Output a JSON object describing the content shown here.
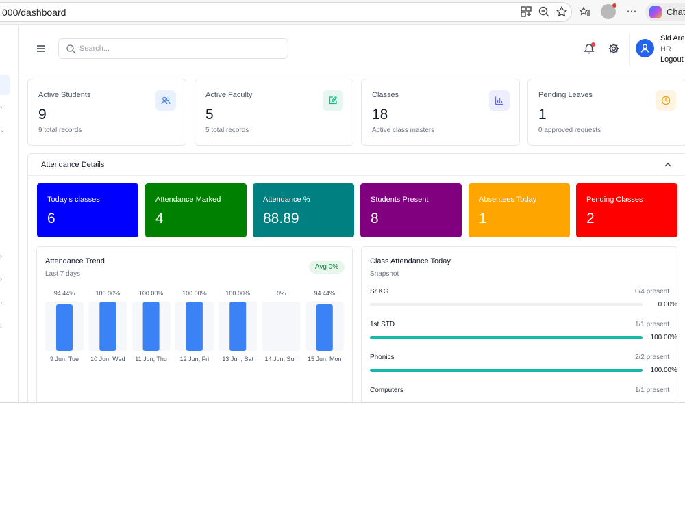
{
  "browser": {
    "url": "000/dashboard",
    "chat_label": "Chat"
  },
  "header": {
    "search_placeholder": "Search...",
    "user": {
      "name": "Sid Arek",
      "role": "HR",
      "logout": "Logout"
    }
  },
  "stat_cards": [
    {
      "title": "Active Students",
      "value": "9",
      "sub": "9 total records",
      "icon": "users-icon",
      "icon_color": "#3b82f6",
      "icon_bg": "#eaf1fe"
    },
    {
      "title": "Active Faculty",
      "value": "5",
      "sub": "5 total records",
      "icon": "edit-square-icon",
      "icon_color": "#10b981",
      "icon_bg": "#e6f7f1"
    },
    {
      "title": "Classes",
      "value": "18",
      "sub": "Active class masters",
      "icon": "bar-chart-icon",
      "icon_color": "#6366f1",
      "icon_bg": "#eceefe"
    },
    {
      "title": "Pending Leaves",
      "value": "1",
      "sub": "0 approved requests",
      "icon": "clock-icon",
      "icon_color": "#f59e0b",
      "icon_bg": "#fff4e0"
    }
  ],
  "attendance": {
    "title": "Attendance Details",
    "cards": [
      {
        "label": "Today's classes",
        "value": "6",
        "color": "#0000ff"
      },
      {
        "label": "Attendance Marked",
        "value": "4",
        "color": "#008000"
      },
      {
        "label": "Attendance %",
        "value": "88.89",
        "color": "#008080"
      },
      {
        "label": "Students Present",
        "value": "8",
        "color": "#800080"
      },
      {
        "label": "Absentees Today",
        "value": "1",
        "color": "#ffa500"
      },
      {
        "label": "Pending Classes",
        "value": "2",
        "color": "#ff0000"
      }
    ]
  },
  "trend": {
    "title": "Attendance Trend",
    "subtitle": "Last 7 days",
    "badge": "Avg 0%"
  },
  "chart_data": {
    "type": "bar",
    "title": "Attendance Trend",
    "subtitle": "Last 7 days",
    "categories": [
      "9 Jun, Tue",
      "10 Jun, Wed",
      "11 Jun, Thu",
      "12 Jun, Fri",
      "13 Jun, Sat",
      "14 Jun, Sun",
      "15 Jun, Mon"
    ],
    "values": [
      94.44,
      100,
      100,
      100,
      100,
      0,
      94.44
    ],
    "value_labels": [
      "94.44%",
      "100.00%",
      "100.00%",
      "100.00%",
      "100.00%",
      "0%",
      "94.44%"
    ],
    "ylim": [
      0,
      100
    ],
    "bar_color": "#3b82f6",
    "track_color": "#f5f7fa",
    "grid": false,
    "legend": false
  },
  "class_attendance": {
    "title": "Class Attendance Today",
    "subtitle": "Snapshot",
    "rows": [
      {
        "name": "Sr KG",
        "present": "0/4 present",
        "pct_label": "0.00%",
        "fraction": 0
      },
      {
        "name": "1st STD",
        "present": "1/1 present",
        "pct_label": "100.00%",
        "fraction": 1
      },
      {
        "name": "Phonics",
        "present": "2/2 present",
        "pct_label": "100.00%",
        "fraction": 1
      },
      {
        "name": "Computers",
        "present": "1/1 present",
        "pct_label": "",
        "fraction": 1
      }
    ]
  }
}
